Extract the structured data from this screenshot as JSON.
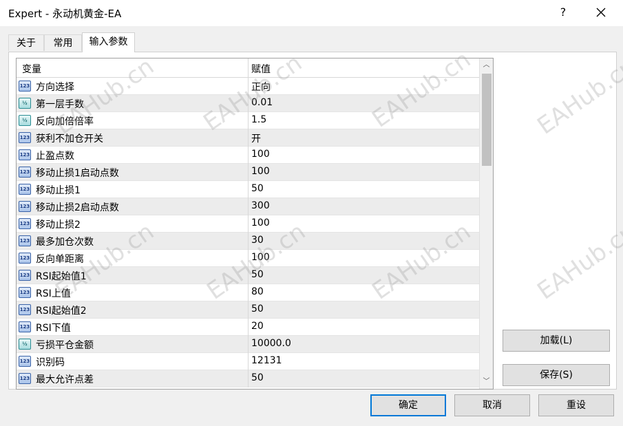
{
  "window": {
    "title": "Expert - 永动机黄金-EA",
    "help_label": "?"
  },
  "tabs": [
    {
      "label": "关于",
      "active": false
    },
    {
      "label": "常用",
      "active": false
    },
    {
      "label": "输入参数",
      "active": true
    }
  ],
  "grid": {
    "headers": {
      "variable": "变量",
      "value": "赋值"
    },
    "rows": [
      {
        "type": "int",
        "icon": "integer-icon",
        "name": "方向选择",
        "value": "正向"
      },
      {
        "type": "double",
        "icon": "double-icon",
        "name": "第一层手数",
        "value": "0.01"
      },
      {
        "type": "double",
        "icon": "double-icon",
        "name": "反向加倍倍率",
        "value": "1.5"
      },
      {
        "type": "int",
        "icon": "integer-icon",
        "name": "获利不加仓开关",
        "value": "开"
      },
      {
        "type": "int",
        "icon": "integer-icon",
        "name": "止盈点数",
        "value": "100"
      },
      {
        "type": "int",
        "icon": "integer-icon",
        "name": "移动止损1启动点数",
        "value": "100"
      },
      {
        "type": "int",
        "icon": "integer-icon",
        "name": "移动止损1",
        "value": "50"
      },
      {
        "type": "int",
        "icon": "integer-icon",
        "name": "移动止损2启动点数",
        "value": "300"
      },
      {
        "type": "int",
        "icon": "integer-icon",
        "name": "移动止损2",
        "value": "100"
      },
      {
        "type": "int",
        "icon": "integer-icon",
        "name": "最多加仓次数",
        "value": "30"
      },
      {
        "type": "int",
        "icon": "integer-icon",
        "name": "反向单距离",
        "value": "100"
      },
      {
        "type": "int",
        "icon": "integer-icon",
        "name": "RSI起始值1",
        "value": "50"
      },
      {
        "type": "int",
        "icon": "integer-icon",
        "name": "RSI上值",
        "value": "80"
      },
      {
        "type": "int",
        "icon": "integer-icon",
        "name": "RSI起始值2",
        "value": "50"
      },
      {
        "type": "int",
        "icon": "integer-icon",
        "name": "RSI下值",
        "value": "20"
      },
      {
        "type": "double",
        "icon": "double-icon",
        "name": "亏损平仓金额",
        "value": "10000.0"
      },
      {
        "type": "int",
        "icon": "integer-icon",
        "name": "识别码",
        "value": "12131"
      },
      {
        "type": "int",
        "icon": "integer-icon",
        "name": "最大允许点差",
        "value": "50"
      }
    ]
  },
  "buttons": {
    "load": "加载(L)",
    "save": "保存(S)",
    "ok": "确定",
    "cancel": "取消",
    "reset": "重设"
  },
  "watermark": "EAHub.cn",
  "colors": {
    "accent": "#0078d7",
    "alt_row": "#ececec"
  }
}
